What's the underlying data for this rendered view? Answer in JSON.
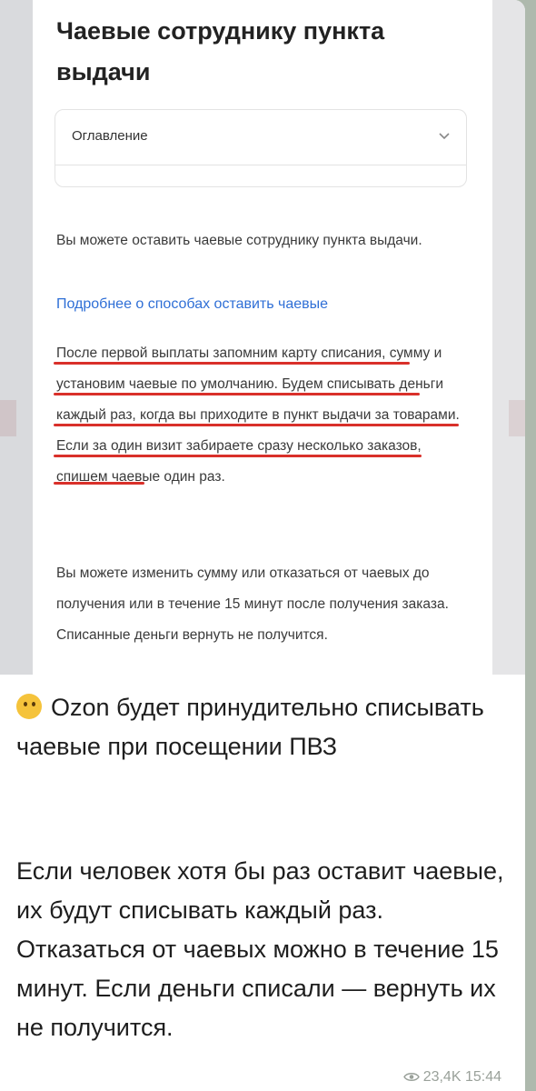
{
  "screenshot": {
    "title": "Чаевые сотруднику пункта выдачи",
    "toc": {
      "label": "Оглавление",
      "chevron_icon": "chevron-down-icon"
    },
    "paragraph1": "Вы можете оставить чаевые сотруднику пункта выдачи.",
    "link": "Подробнее о способах оставить чаевые",
    "paragraph2": "После первой выплаты запомним карту списания, сумму и установим чаевые по умолчанию. Будем списывать деньги каждый раз, когда вы приходите в пункт выдачи за товарами. Если за один визит забираете сразу несколько заказов, спишем чаевые один раз.",
    "paragraph3": "Вы можете изменить сумму или отказаться от чаевых до получения или в течение 15 минут после получения заказа. Списанные деньги вернуть не получится.",
    "underline_color": "#d9302a"
  },
  "message": {
    "emoji": "thinking-face-icon",
    "headline": "Ozon будет принудительно списывать чаевые при посещении ПВЗ",
    "body": "Если человек хотя бы раз оставит чаевые, их будут списывать каждый раз. Отказаться от чаевых можно в течение 15 минут. Если деньги списали — вернуть их не получится.",
    "views": "23,4K",
    "time": "15:44"
  }
}
